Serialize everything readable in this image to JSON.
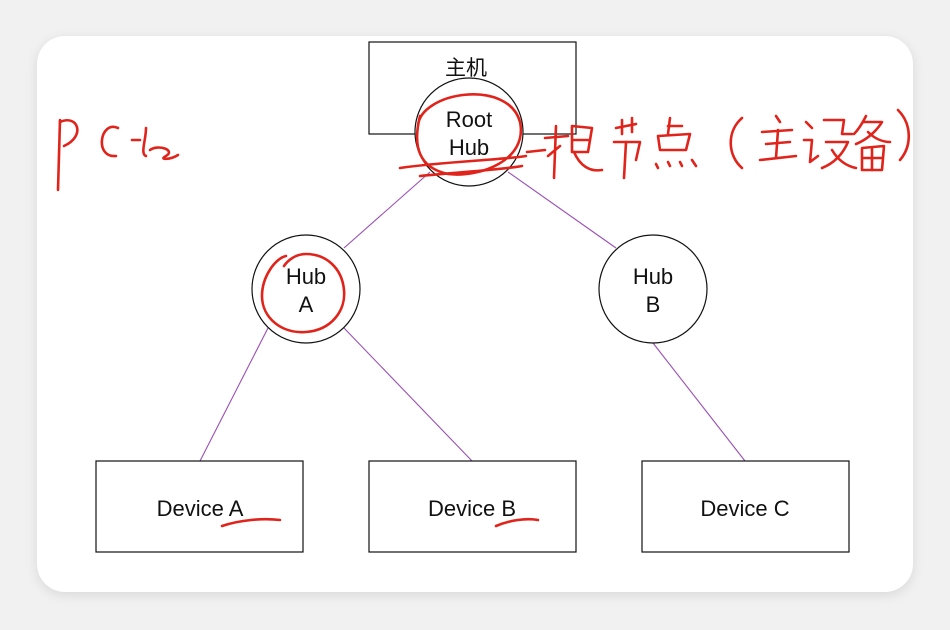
{
  "diagram": {
    "host_label": "主机",
    "root_hub": {
      "line1": "Root",
      "line2": "Hub"
    },
    "hub_a": {
      "line1": "Hub",
      "line2": "A"
    },
    "hub_b": {
      "line1": "Hub",
      "line2": "B"
    },
    "device_a": "Device A",
    "device_b": "Device B",
    "device_c": "Device C"
  },
  "handwritten_annotations": {
    "left": "PCIe",
    "right": "根节点(主设备)"
  },
  "colors": {
    "edge": "#9b4fb5",
    "annotation_ink": "#e0241b",
    "node_stroke": "#111111",
    "background": "#f1f1f1",
    "card": "#ffffff"
  }
}
